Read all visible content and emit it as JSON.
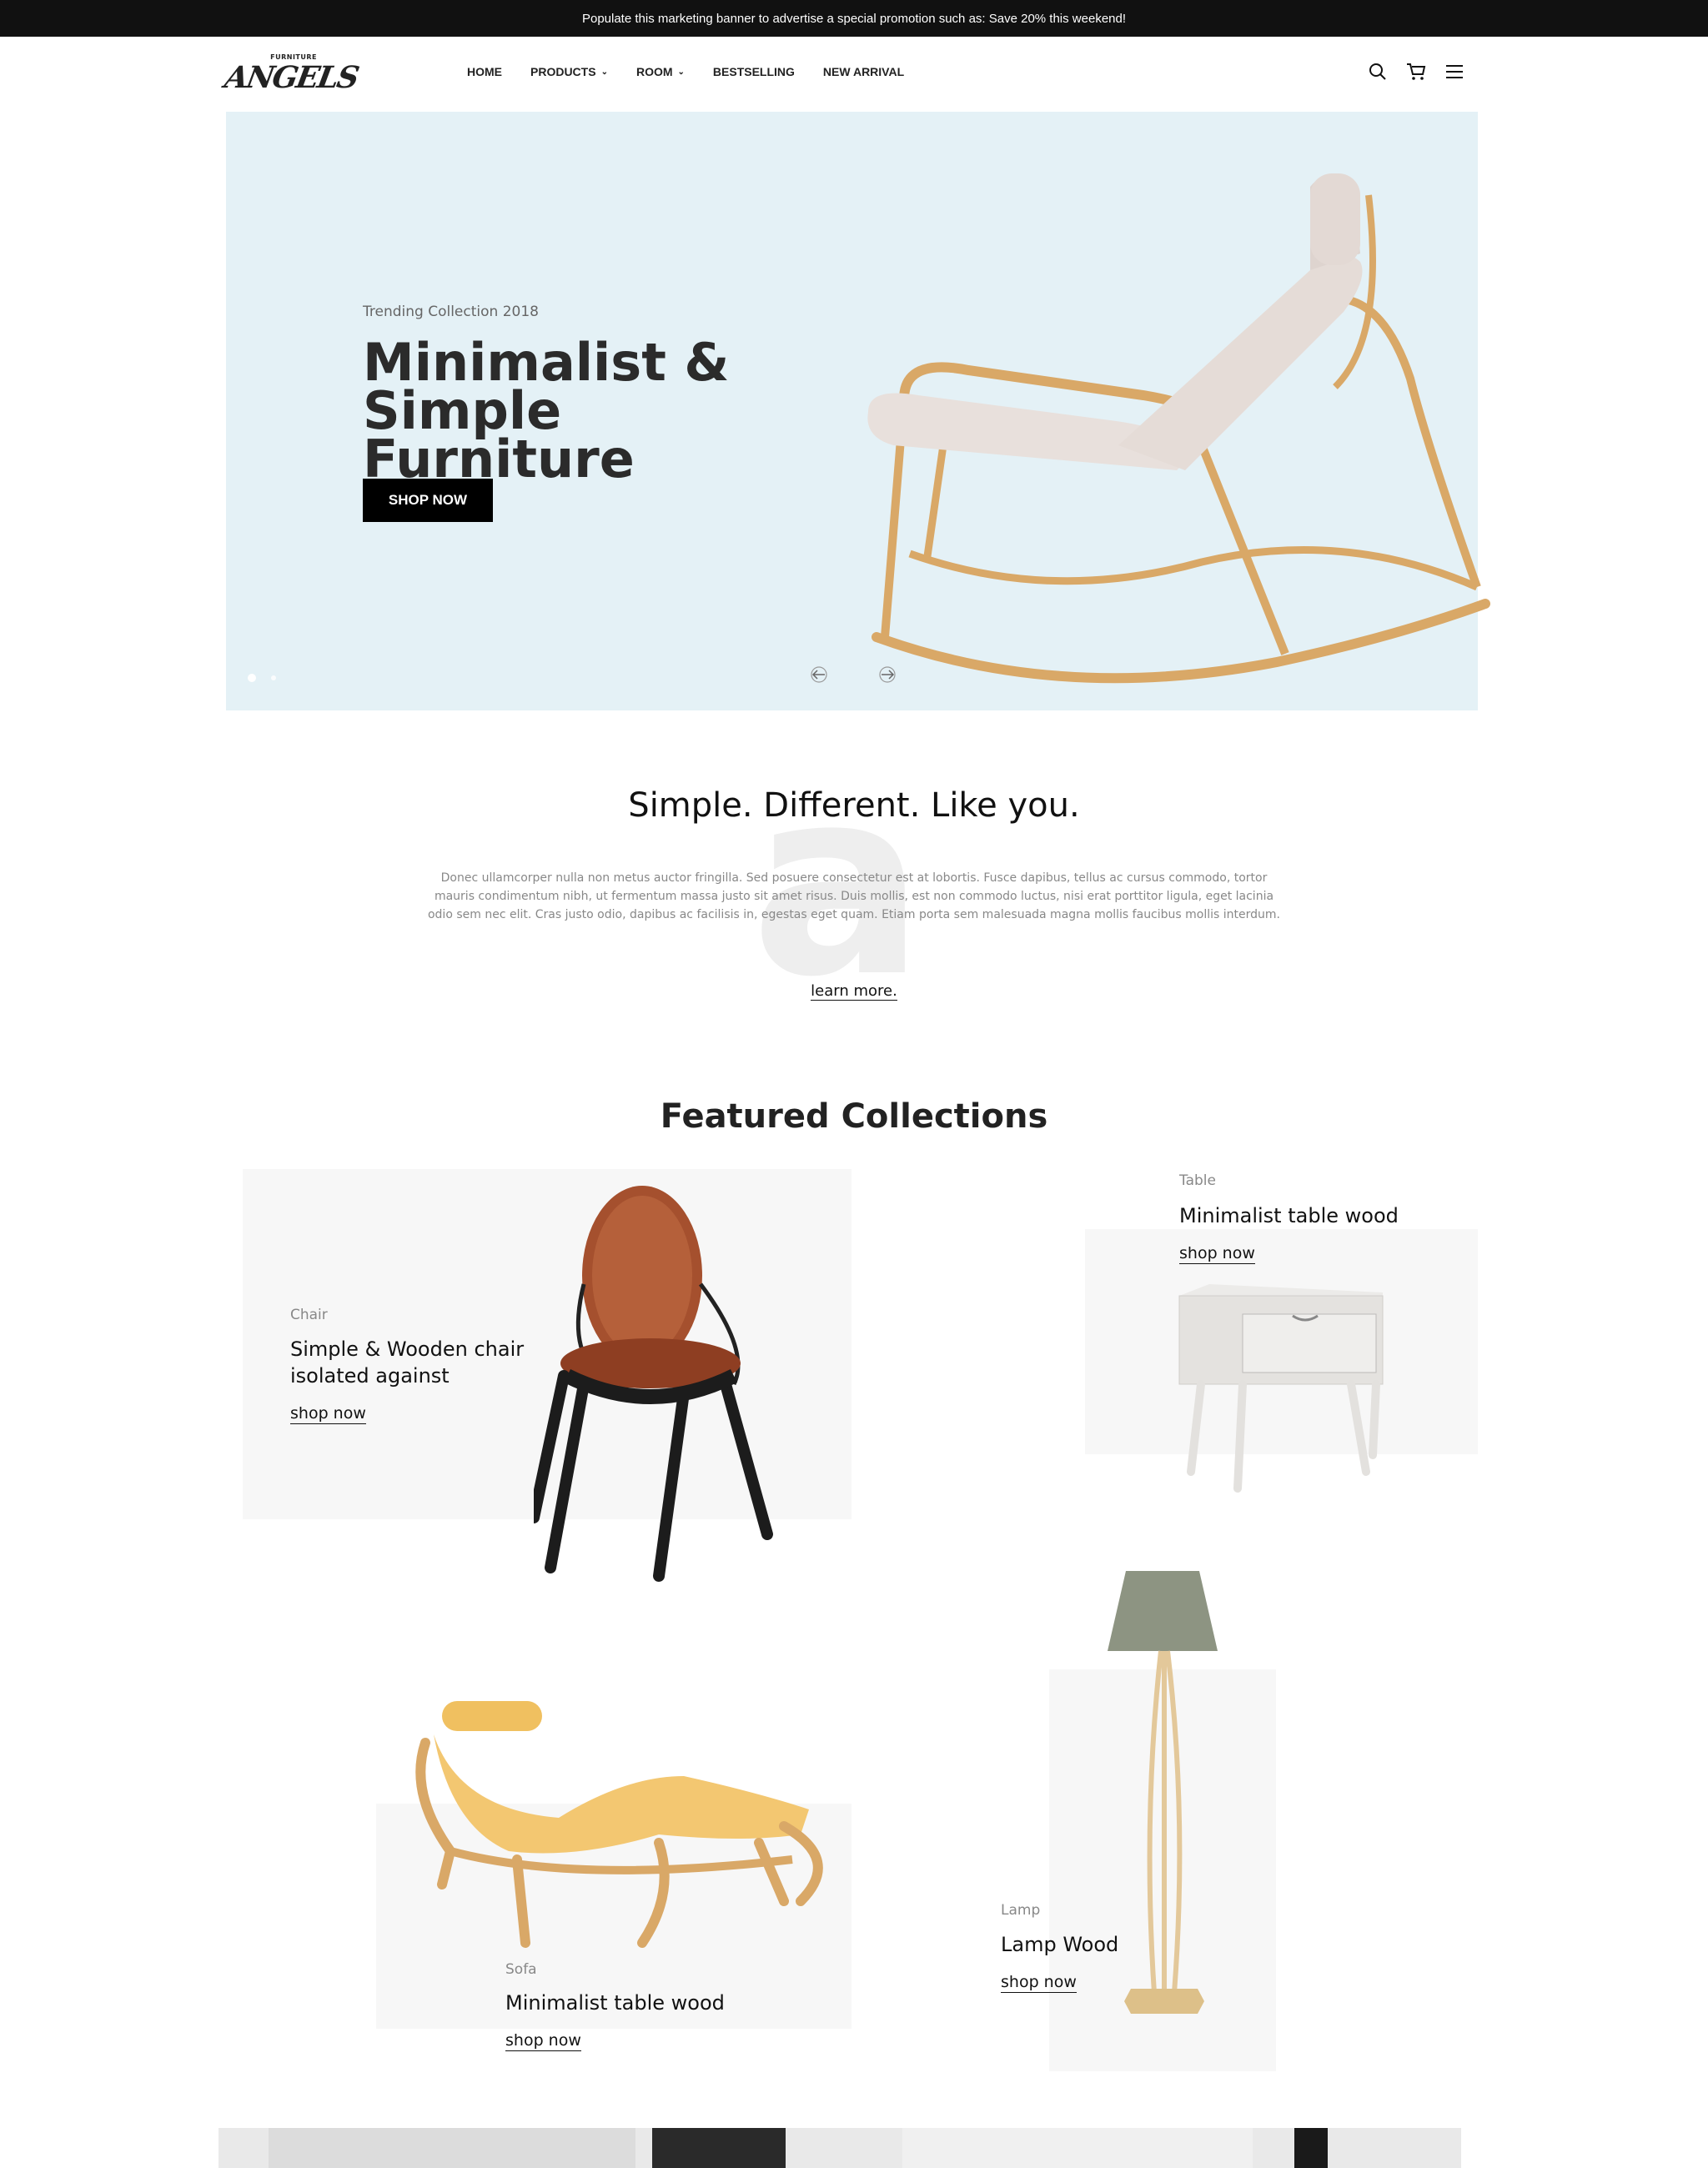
{
  "promo": {
    "text": "Populate this marketing banner to advertise a special promotion such as: Save 20% this weekend!"
  },
  "logo": {
    "small": "FURNITURE",
    "big": "ANGELS"
  },
  "nav": {
    "items": [
      {
        "label": "HOME",
        "dropdown": false
      },
      {
        "label": "PRODUCTS",
        "dropdown": true
      },
      {
        "label": "ROOM",
        "dropdown": true
      },
      {
        "label": "BESTSELLING",
        "dropdown": false
      },
      {
        "label": "NEW ARRIVAL",
        "dropdown": false
      }
    ]
  },
  "header_icons": [
    "search-icon",
    "cart-icon",
    "menu-icon"
  ],
  "hero": {
    "eyebrow": "Trending Collection 2018",
    "title": "Minimalist & Simple Furniture",
    "button": "SHOP NOW",
    "slides_count": 2,
    "active_slide": 1,
    "bg_color": "#e4f1f6"
  },
  "intro": {
    "watermark": "a",
    "title": "Simple. Different. Like you.",
    "body": "Donec ullamcorper nulla non metus auctor fringilla. Sed posuere consectetur est at lobortis. Fusce dapibus, tellus ac cursus commodo, tortor mauris condimentum nibh, ut fermentum massa justo sit amet risus. Duis mollis, est non commodo luctus, nisi erat porttitor ligula, eget lacinia odio sem nec elit. Cras justo odio, dapibus ac facilisis in, egestas eget quam. Etiam porta sem malesuada magna mollis faucibus mollis interdum.",
    "link": "learn more."
  },
  "featured": {
    "title": "Featured Collections",
    "cards": [
      {
        "category": "Chair",
        "title": "Simple & Wooden chair isolated against",
        "link": "shop now"
      },
      {
        "category": "Table",
        "title": "Minimalist table wood",
        "link": "shop now"
      },
      {
        "category": "Sofa",
        "title": "Minimalist table wood",
        "link": "shop now"
      },
      {
        "category": "Lamp",
        "title": "Lamp Wood",
        "link": "shop now"
      }
    ]
  }
}
